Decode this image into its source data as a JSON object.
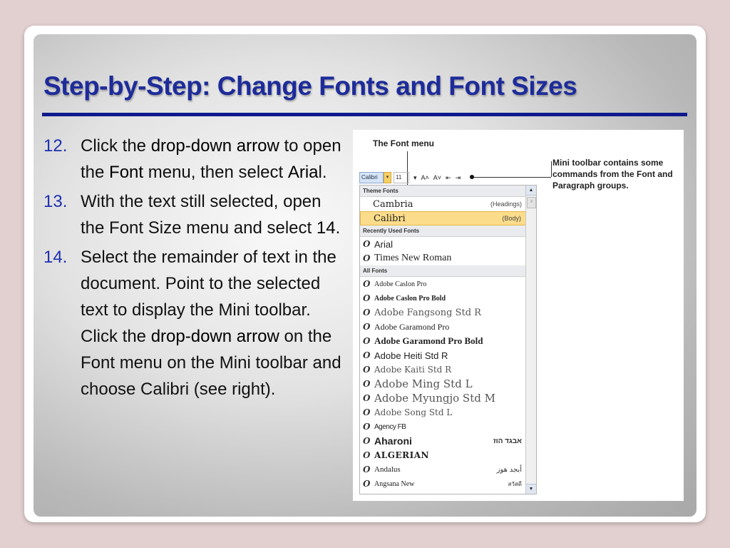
{
  "slide": {
    "title": "Step-by-Step: Change Fonts and Font Sizes"
  },
  "steps": [
    {
      "number": "12.",
      "parts": [
        "Click the ",
        "drop-down arrow",
        " to open the ",
        "Font",
        " menu, then select ",
        "Aria",
        "l."
      ]
    },
    {
      "number": "13.",
      "parts": [
        " With the text still selected, open the Font Size menu and select ",
        "14",
        "."
      ]
    },
    {
      "number": "14.",
      "parts": [
        " Select the remainder of text in the document. Point to the selected text to display the Mini toolbar. Click the ",
        "drop-down arrow",
        " on the Font menu on the Mini toolbar and choose Calibri (see right)."
      ]
    }
  ],
  "figure": {
    "title": "The Font menu",
    "callout": "Mini toolbar contains some commands from the Font and Paragraph groups.",
    "toolbar": {
      "font_value": "Calibri",
      "size_value": "11",
      "dropdown_glyph": "▾",
      "grow_icon": "A˄",
      "shrink_icon": "A˅",
      "decrease_indent_icon": "⇤",
      "increase_indent_icon": "⇥"
    },
    "sections": {
      "theme": "Theme Fonts",
      "recent": "Recently Used Fonts",
      "all": "All Fonts"
    },
    "theme_fonts": [
      {
        "name": "Cambria",
        "tag": "(Headings)"
      },
      {
        "name": "Calibri",
        "tag": "(Body)"
      }
    ],
    "recent_fonts": [
      "Arial",
      "Times New Roman"
    ],
    "all_fonts": [
      {
        "name": "Adobe Caslon Pro",
        "extra": ""
      },
      {
        "name": "Adobe Caslon Pro Bold",
        "extra": ""
      },
      {
        "name": "Adobe Fangsong Std R",
        "extra": ""
      },
      {
        "name": "Adobe Garamond Pro",
        "extra": ""
      },
      {
        "name": "Adobe Garamond Pro Bold",
        "extra": ""
      },
      {
        "name": "Adobe Heiti Std R",
        "extra": ""
      },
      {
        "name": "Adobe Kaiti Std R",
        "extra": ""
      },
      {
        "name": "Adobe Ming Std L",
        "extra": ""
      },
      {
        "name": "Adobe Myungjo Std M",
        "extra": ""
      },
      {
        "name": "Adobe Song Std L",
        "extra": ""
      },
      {
        "name": "Agency FB",
        "extra": ""
      },
      {
        "name": "Aharoni",
        "extra": "אבגד הוז"
      },
      {
        "name": "ALGERIAN",
        "extra": ""
      },
      {
        "name": "Andalus",
        "extra": "أبجد هوز"
      },
      {
        "name": "Angsana New",
        "extra": "สวัสดี"
      }
    ],
    "font_icon": "O",
    "scroll_up": "▲",
    "scroll_down": "▼",
    "scroll_grip": "≡"
  }
}
